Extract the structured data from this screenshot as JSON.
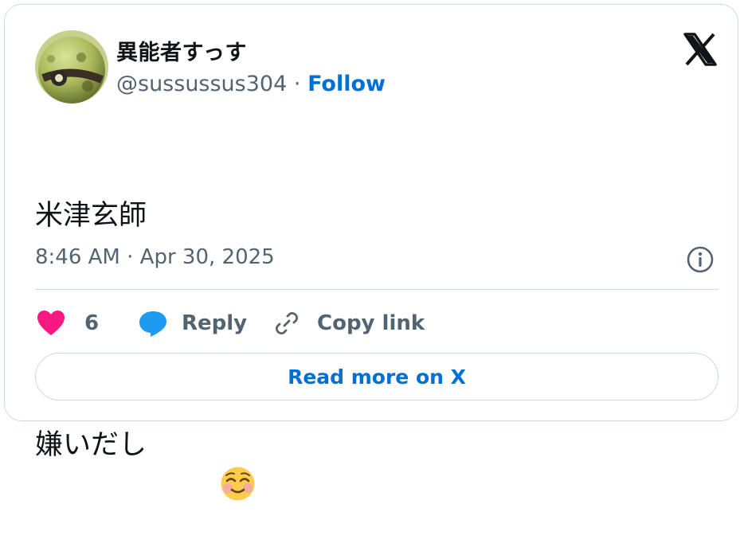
{
  "author": {
    "display_name": "異能者すっす",
    "handle": "@sussussus304",
    "separator": "·",
    "follow_label": "Follow"
  },
  "tweet": {
    "line1": "米津玄師",
    "line2": "嫌いだし",
    "emoji": "smiling-face-with-smiling-eyes"
  },
  "meta": {
    "timestamp": "8:46 AM · Apr 30, 2025"
  },
  "actions": {
    "like_count": "6",
    "reply_label": "Reply",
    "copy_label": "Copy link"
  },
  "read_more_label": "Read more on X",
  "colors": {
    "like": "#f91880",
    "reply": "#1d9bf0",
    "link": "#006fd6",
    "muted": "#536471",
    "border": "#cfd9de"
  }
}
